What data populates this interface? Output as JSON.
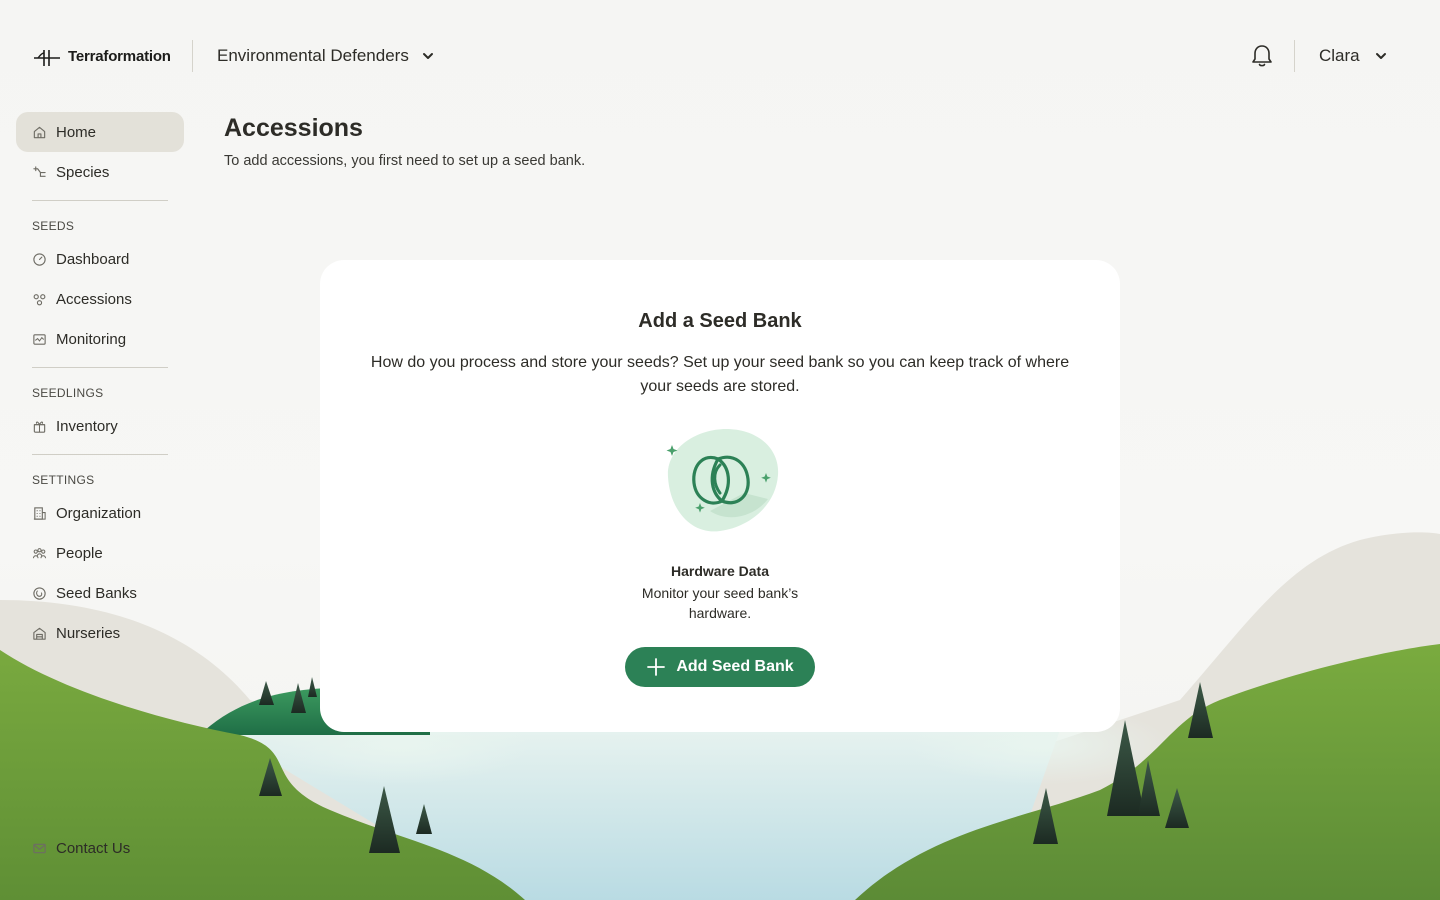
{
  "header": {
    "logo_text": "Terraformation",
    "org_name": "Environmental Defenders",
    "user_name": "Clara"
  },
  "sidebar": {
    "home": "Home",
    "species": "Species",
    "seeds_title": "SEEDS",
    "dashboard": "Dashboard",
    "accessions": "Accessions",
    "monitoring": "Monitoring",
    "seedlings_title": "SEEDLINGS",
    "inventory": "Inventory",
    "settings_title": "SETTINGS",
    "organization": "Organization",
    "people": "People",
    "seed_banks": "Seed Banks",
    "nurseries": "Nurseries",
    "contact": "Contact Us",
    "active_item": "Home"
  },
  "main": {
    "title": "Accessions",
    "subtitle": "To add accessions, you first need to set up a seed bank.",
    "card": {
      "title": "Add a Seed Bank",
      "description": "How do you process and store your seeds? Set up your seed bank so you can keep track of where your seeds are stored.",
      "feature_title": "Hardware Data",
      "feature_desc": "Monitor your seed bank’s hardware.",
      "button_label": "Add Seed Bank"
    }
  },
  "colors": {
    "accent": "#2c8156",
    "sidebar_active": "#e3e1d9",
    "hill_green": "#6a9a3c",
    "water": "#cfe6ea"
  },
  "icons": [
    "home-icon",
    "species-icon",
    "dashboard-icon",
    "accessions-icon",
    "monitoring-icon",
    "inventory-icon",
    "organization-icon",
    "people-icon",
    "seed-banks-icon",
    "nurseries-icon",
    "mail-icon",
    "bell-icon",
    "chevron-down-icon",
    "plus-icon"
  ]
}
